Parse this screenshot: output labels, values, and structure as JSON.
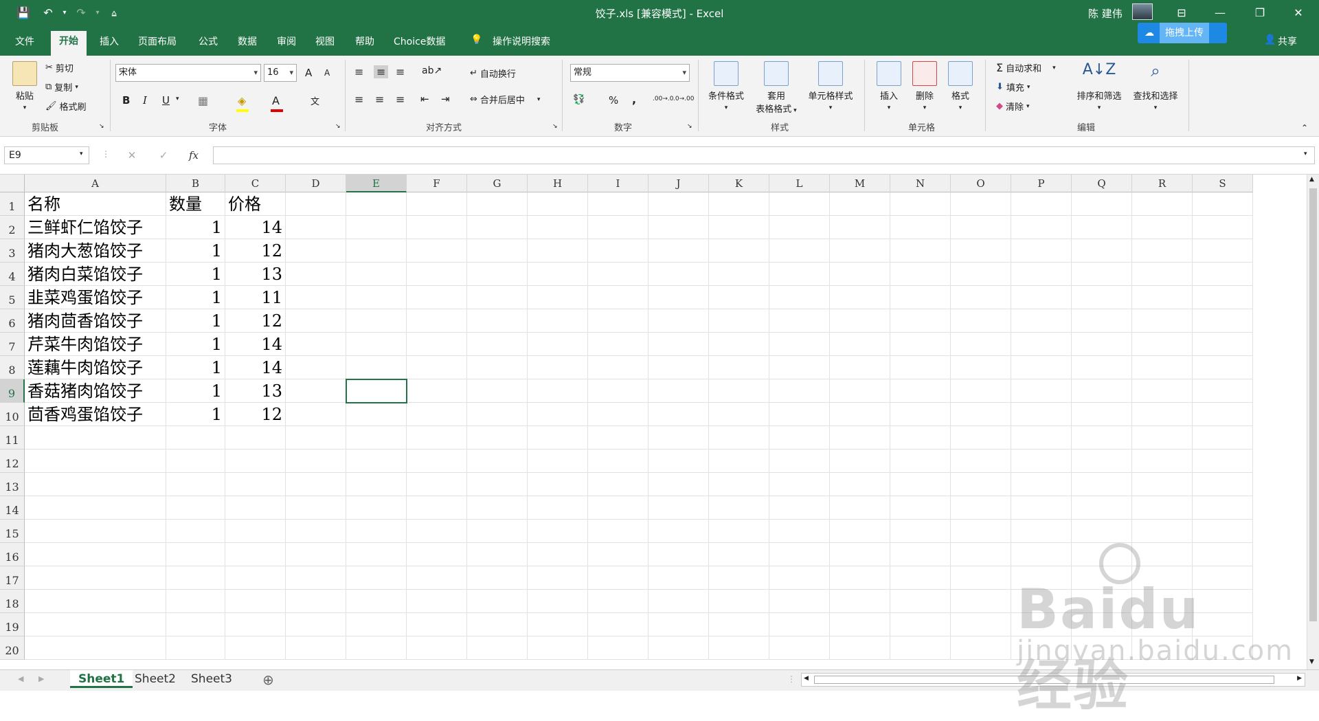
{
  "window": {
    "title": "饺子.xls  [兼容模式]  -  Excel",
    "user": "陈 建伟"
  },
  "tabs": [
    "文件",
    "开始",
    "插入",
    "页面布局",
    "公式",
    "数据",
    "审阅",
    "视图",
    "帮助",
    "Choice数据"
  ],
  "active_tab": "开始",
  "search_label": "操作说明搜索",
  "share_label": "共享",
  "cloud_upload": "拖拽上传",
  "ribbon": {
    "clipboard": {
      "label": "剪贴板",
      "paste": "粘贴",
      "cut": "剪切",
      "copy": "复制",
      "format_painter": "格式刷"
    },
    "font": {
      "label": "字体",
      "font_name": "宋体",
      "font_size": "16",
      "bold": "B",
      "italic": "I",
      "underline": "U",
      "phonetic": "文",
      "grow": "A",
      "shrink": "A"
    },
    "alignment": {
      "label": "对齐方式",
      "wrap": "自动换行",
      "merge": "合并后居中"
    },
    "number": {
      "label": "数字",
      "format": "常规",
      "percent": "%",
      "comma": ",",
      "inc_decimal": ".00→.0",
      "dec_decimal": ".0→.00"
    },
    "styles": {
      "label": "样式",
      "conditional": "条件格式",
      "table_1": "套用",
      "table_2": "表格格式",
      "cell_styles": "单元格样式"
    },
    "cells": {
      "label": "单元格",
      "insert": "插入",
      "delete": "删除",
      "format": "格式"
    },
    "editing": {
      "label": "编辑",
      "autosum": "自动求和",
      "fill": "填充",
      "clear": "清除",
      "sort": "排序和筛选",
      "find": "查找和选择"
    }
  },
  "formula": {
    "name_box": "E9",
    "content": "",
    "fx": "fx"
  },
  "columns": [
    "A",
    "B",
    "C",
    "D",
    "E",
    "F",
    "G",
    "H",
    "I",
    "J",
    "K",
    "L",
    "M",
    "N",
    "O",
    "P",
    "Q",
    "R",
    "S"
  ],
  "rows": [
    {
      "n": "1",
      "a": "名称",
      "b": "数量",
      "c": "价格"
    },
    {
      "n": "2",
      "a": "三鲜虾仁馅饺子",
      "b": "1",
      "c": "14"
    },
    {
      "n": "3",
      "a": "猪肉大葱馅饺子",
      "b": "1",
      "c": "12"
    },
    {
      "n": "4",
      "a": "猪肉白菜馅饺子",
      "b": "1",
      "c": "13"
    },
    {
      "n": "5",
      "a": "韭菜鸡蛋馅饺子",
      "b": "1",
      "c": "11"
    },
    {
      "n": "6",
      "a": "猪肉茴香馅饺子",
      "b": "1",
      "c": "12"
    },
    {
      "n": "7",
      "a": "芹菜牛肉馅饺子",
      "b": "1",
      "c": "14"
    },
    {
      "n": "8",
      "a": "莲藕牛肉馅饺子",
      "b": "1",
      "c": "14"
    },
    {
      "n": "9",
      "a": "香菇猪肉馅饺子",
      "b": "1",
      "c": "13"
    },
    {
      "n": "10",
      "a": "茴香鸡蛋馅饺子",
      "b": "1",
      "c": "12"
    },
    {
      "n": "11",
      "a": "",
      "b": "",
      "c": ""
    },
    {
      "n": "12",
      "a": "",
      "b": "",
      "c": ""
    },
    {
      "n": "13",
      "a": "",
      "b": "",
      "c": ""
    },
    {
      "n": "14",
      "a": "",
      "b": "",
      "c": ""
    },
    {
      "n": "15",
      "a": "",
      "b": "",
      "c": ""
    },
    {
      "n": "16",
      "a": "",
      "b": "",
      "c": ""
    },
    {
      "n": "17",
      "a": "",
      "b": "",
      "c": ""
    },
    {
      "n": "18",
      "a": "",
      "b": "",
      "c": ""
    },
    {
      "n": "19",
      "a": "",
      "b": "",
      "c": ""
    },
    {
      "n": "20",
      "a": "",
      "b": "",
      "c": ""
    }
  ],
  "selected_cell": "E9",
  "sheets": [
    "Sheet1",
    "Sheet2",
    "Sheet3"
  ],
  "active_sheet": "Sheet1",
  "watermark": {
    "brand": "Baidu经验",
    "url": "jingyan.baidu.com"
  },
  "colors": {
    "accent": "#217346"
  }
}
